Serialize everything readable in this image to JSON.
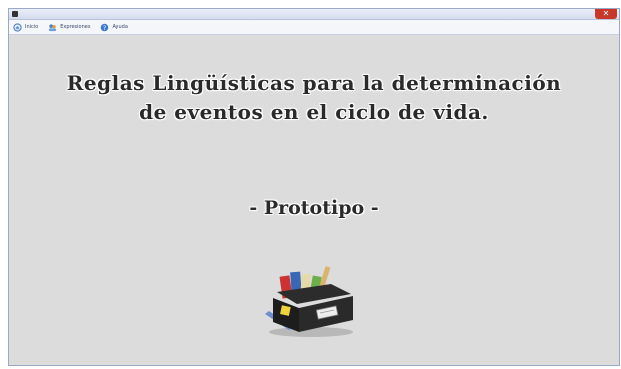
{
  "window": {
    "title": "",
    "close_label": "✕"
  },
  "toolbar": {
    "items": [
      {
        "label": "Inicio",
        "icon": "home-icon"
      },
      {
        "label": "Expresiones",
        "icon": "users-icon"
      },
      {
        "label": "Ayuda",
        "icon": "help-icon"
      }
    ]
  },
  "main": {
    "heading_line1": "Reglas Lingüísticas para la determinación",
    "heading_line2": "de eventos en el ciclo de vida.",
    "subtitle": "- Prototipo -",
    "illustration": "file-box-icon"
  },
  "colors": {
    "background": "#dcdcdc",
    "text": "#2a2a2a",
    "close_button": "#c7372a"
  }
}
